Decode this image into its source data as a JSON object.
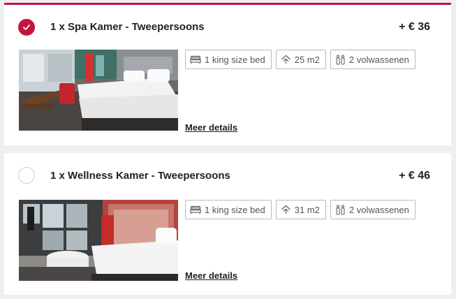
{
  "rooms": [
    {
      "selected": true,
      "title": "1 x Spa Kamer - Tweepersoons",
      "price": "+ € 36",
      "features": {
        "bed": "1 king size bed",
        "size": "25 m2",
        "guests": "2 volwassenen"
      },
      "details_label": "Meer details"
    },
    {
      "selected": false,
      "title": "1 x Wellness Kamer - Tweepersoons",
      "price": "+ € 46",
      "features": {
        "bed": "1 king size bed",
        "size": "31 m2",
        "guests": "2 volwassenen"
      },
      "details_label": "Meer details"
    }
  ],
  "colors": {
    "accent": "#c2163f",
    "background": "#efefef",
    "card": "#ffffff"
  },
  "icons": [
    "check-icon",
    "bed-icon",
    "room-size-icon",
    "adults-icon"
  ]
}
